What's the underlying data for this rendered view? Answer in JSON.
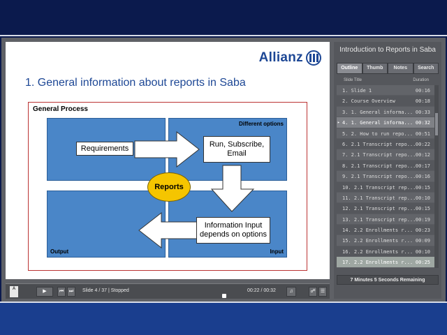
{
  "slide": {
    "logo_text": "Allianz",
    "title": "1. General information about reports in Saba",
    "diagram": {
      "title": "General Process",
      "label_different_options": "Different options",
      "label_output": "Output",
      "label_input": "Input",
      "box_requirements": "Requirements",
      "box_run": "Run, Subscribe, Email",
      "box_info_input": "Information Input depends on options",
      "center": "Reports",
      "colors": {
        "quadrant": "#4a86c8",
        "center": "#f5c500"
      }
    }
  },
  "sidebar": {
    "title": "Introduction to Reports in Saba",
    "tabs": [
      "Outline",
      "Thumb",
      "Notes",
      "Search"
    ],
    "active_tab": "Outline",
    "header_title": "Slide Title",
    "header_duration": "Duration",
    "slides": [
      {
        "title": "1. Slide 1",
        "duration": "00:16"
      },
      {
        "title": "2. Course Overview",
        "duration": "00:18"
      },
      {
        "title": "3. 1. General informa...",
        "duration": "00:33"
      },
      {
        "title": "4. 1. General informa...",
        "duration": "00:32"
      },
      {
        "title": "5. 2. How to run repo...",
        "duration": "00:51"
      },
      {
        "title": "6. 2.1 Transcript repo...",
        "duration": "00:22"
      },
      {
        "title": "7. 2.1 Transcript repo...",
        "duration": "00:12"
      },
      {
        "title": "8. 2.1 Transcript repo...",
        "duration": "00:17"
      },
      {
        "title": "9. 2.1 Transcript repo...",
        "duration": "00:16"
      },
      {
        "title": "10. 2.1 Transcript rep...",
        "duration": "00:15"
      },
      {
        "title": "11. 2.1 Transcript rep...",
        "duration": "00:10"
      },
      {
        "title": "12. 2.1 Transcript rep...",
        "duration": "00:15"
      },
      {
        "title": "13. 2.1 Transcript rep...",
        "duration": "00:19"
      },
      {
        "title": "14. 2.2 Enrollments r...",
        "duration": "00:23"
      },
      {
        "title": "15. 2.2 Enrollments r...",
        "duration": "00:09"
      },
      {
        "title": "16. 2.2 Enrollments r...",
        "duration": "00:10"
      },
      {
        "title": "17. 2.2 Enrollments r...",
        "duration": "00:25"
      }
    ],
    "current_index": 3,
    "remaining": "7 Minutes 5 Seconds Remaining"
  },
  "controls": {
    "status": "Slide 4 / 37 | Stopped",
    "time": "00:22 / 00:32",
    "adobe_label": "Adobe",
    "play_icon": "play-icon",
    "prev_icon": "skip-back-icon",
    "next_icon": "skip-forward-icon",
    "volume_icon": "volume-icon",
    "attach_icon": "paperclip-icon",
    "notes_icon": "notes-icon"
  }
}
